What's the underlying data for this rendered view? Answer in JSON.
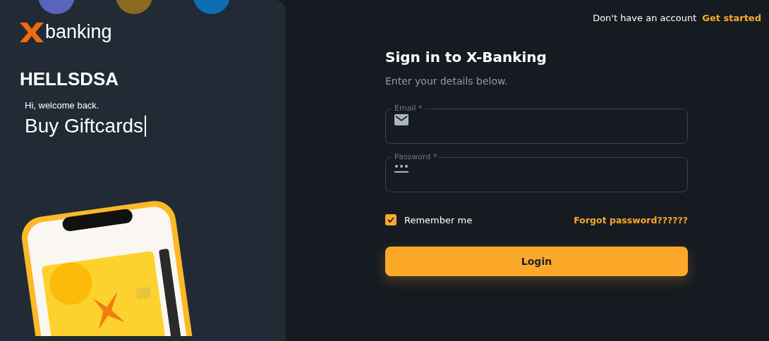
{
  "brand": {
    "logo_text": "banking"
  },
  "hero": {
    "title": "HELLSDSA",
    "greeting": "Hi, welcome back.",
    "typed_text": "Buy Giftcards",
    "cursor": true
  },
  "header": {
    "prompt": "Don't have an account",
    "link": "Get started"
  },
  "form": {
    "title": "Sign in to X-Banking",
    "subtitle": "Enter your details below.",
    "fields": [
      {
        "kind": "email",
        "label": "Email *"
      },
      {
        "kind": "password",
        "label": "Password *"
      }
    ],
    "remember": {
      "label": "Remember me",
      "checked": true
    },
    "forgot": "Forgot password??????",
    "submit": "Login"
  }
}
